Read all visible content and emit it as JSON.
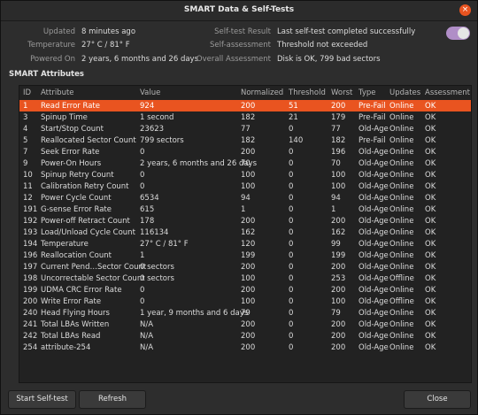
{
  "window": {
    "title": "SMART Data & Self-Tests",
    "close_glyph": "×"
  },
  "info": {
    "updated_label": "Updated",
    "updated_value": "8 minutes ago",
    "temperature_label": "Temperature",
    "temperature_value": "27° C / 81° F",
    "powered_on_label": "Powered On",
    "powered_on_value": "2 years, 6 months and 26 days",
    "self_test_label": "Self-test Result",
    "self_test_value": "Last self-test completed successfully",
    "self_assessment_label": "Self-assessment",
    "self_assessment_value": "Threshold not exceeded",
    "overall_label": "Overall Assessment",
    "overall_value": "Disk is OK, 799 bad sectors"
  },
  "smart_toggle": {
    "on": true,
    "accent": "#b08ec7"
  },
  "section_title": "SMART Attributes",
  "table": {
    "headers": [
      "ID",
      "Attribute",
      "Value",
      "Normalized",
      "Threshold",
      "Worst",
      "Type",
      "Updates",
      "Assessment"
    ],
    "selected_index": 0,
    "rows": [
      [
        "1",
        "Read Error Rate",
        "924",
        "200",
        "51",
        "200",
        "Pre-Fail",
        "Online",
        "OK"
      ],
      [
        "3",
        "Spinup Time",
        "1 second",
        "182",
        "21",
        "179",
        "Pre-Fail",
        "Online",
        "OK"
      ],
      [
        "4",
        "Start/Stop Count",
        "23623",
        "77",
        "0",
        "77",
        "Old-Age",
        "Online",
        "OK"
      ],
      [
        "5",
        "Reallocated Sector Count",
        "799 sectors",
        "182",
        "140",
        "182",
        "Pre-Fail",
        "Online",
        "OK"
      ],
      [
        "7",
        "Seek Error Rate",
        "0",
        "200",
        "0",
        "196",
        "Old-Age",
        "Online",
        "OK"
      ],
      [
        "9",
        "Power-On Hours",
        "2 years, 6 months and 26 days",
        "70",
        "0",
        "70",
        "Old-Age",
        "Online",
        "OK"
      ],
      [
        "10",
        "Spinup Retry Count",
        "0",
        "100",
        "0",
        "100",
        "Old-Age",
        "Online",
        "OK"
      ],
      [
        "11",
        "Calibration Retry Count",
        "0",
        "100",
        "0",
        "100",
        "Old-Age",
        "Online",
        "OK"
      ],
      [
        "12",
        "Power Cycle Count",
        "6534",
        "94",
        "0",
        "94",
        "Old-Age",
        "Online",
        "OK"
      ],
      [
        "191",
        "G-sense Error Rate",
        "615",
        "1",
        "0",
        "1",
        "Old-Age",
        "Online",
        "OK"
      ],
      [
        "192",
        "Power-off Retract Count",
        "178",
        "200",
        "0",
        "200",
        "Old-Age",
        "Online",
        "OK"
      ],
      [
        "193",
        "Load/Unload Cycle Count",
        "116134",
        "162",
        "0",
        "162",
        "Old-Age",
        "Online",
        "OK"
      ],
      [
        "194",
        "Temperature",
        "27° C / 81° F",
        "120",
        "0",
        "99",
        "Old-Age",
        "Online",
        "OK"
      ],
      [
        "196",
        "Reallocation Count",
        "1",
        "199",
        "0",
        "199",
        "Old-Age",
        "Online",
        "OK"
      ],
      [
        "197",
        "Current Pend…Sector Count",
        "0 sectors",
        "200",
        "0",
        "200",
        "Old-Age",
        "Online",
        "OK"
      ],
      [
        "198",
        "Uncorrectable Sector Count",
        "0 sectors",
        "100",
        "0",
        "253",
        "Old-Age",
        "Offline",
        "OK"
      ],
      [
        "199",
        "UDMA CRC Error Rate",
        "0",
        "200",
        "0",
        "200",
        "Old-Age",
        "Online",
        "OK"
      ],
      [
        "200",
        "Write Error Rate",
        "0",
        "100",
        "0",
        "100",
        "Old-Age",
        "Offline",
        "OK"
      ],
      [
        "240",
        "Head Flying Hours",
        "1 year, 9 months and 6 days",
        "79",
        "0",
        "79",
        "Old-Age",
        "Online",
        "OK"
      ],
      [
        "241",
        "Total LBAs Written",
        "N/A",
        "200",
        "0",
        "200",
        "Old-Age",
        "Online",
        "OK"
      ],
      [
        "242",
        "Total LBAs Read",
        "N/A",
        "200",
        "0",
        "200",
        "Old-Age",
        "Online",
        "OK"
      ],
      [
        "254",
        "attribute-254",
        "N/A",
        "200",
        "0",
        "200",
        "Old-Age",
        "Online",
        "OK"
      ]
    ]
  },
  "buttons": {
    "start_self_test": "Start Self-test",
    "refresh": "Refresh",
    "close": "Close"
  },
  "colors": {
    "selection": "#e95420"
  }
}
